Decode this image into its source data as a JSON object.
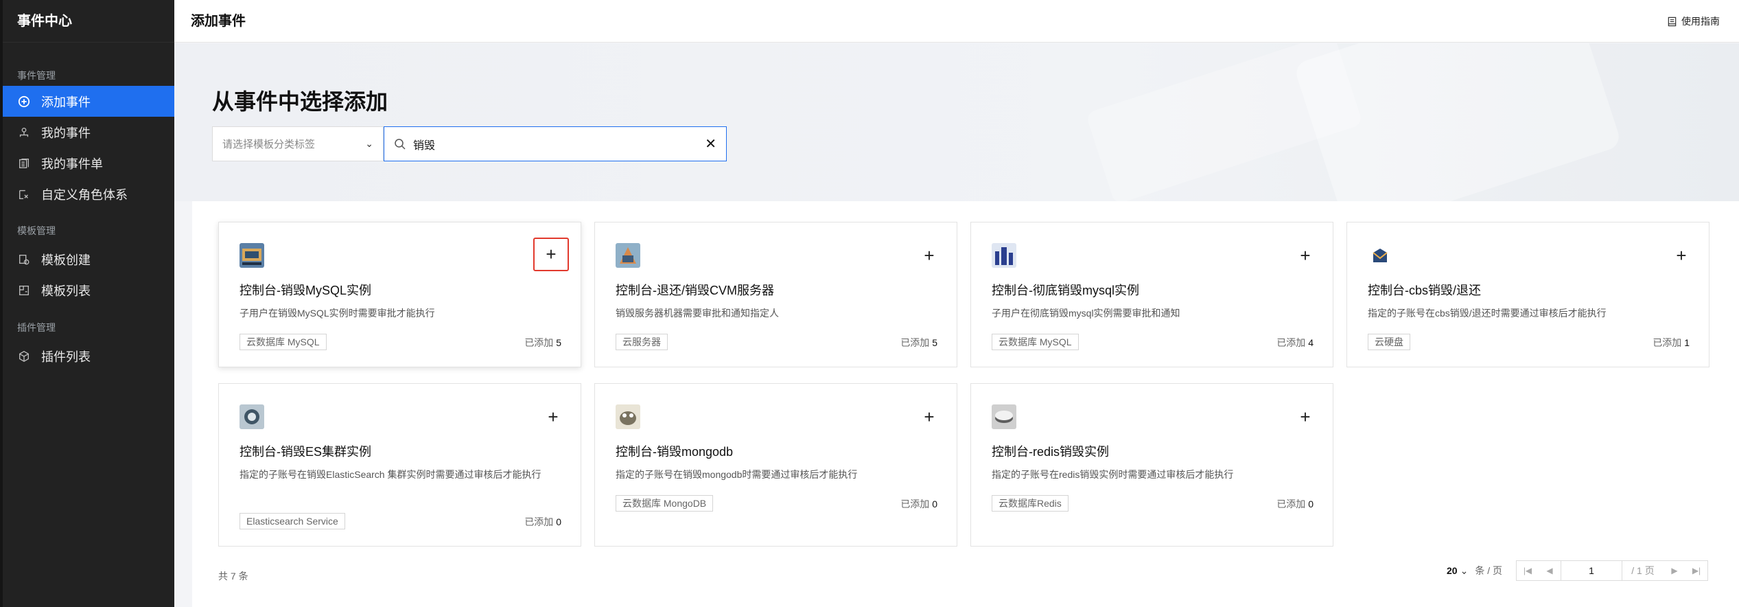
{
  "app": {
    "title": "事件中心"
  },
  "sidebar": {
    "groups": [
      {
        "title": "事件管理",
        "items": [
          {
            "label": "添加事件",
            "icon": "plus-circle-icon",
            "active": true
          },
          {
            "label": "我的事件",
            "icon": "user-org-icon"
          },
          {
            "label": "我的事件单",
            "icon": "document-list-icon"
          },
          {
            "label": "自定义角色体系",
            "icon": "role-system-icon"
          }
        ]
      },
      {
        "title": "模板管理",
        "items": [
          {
            "label": "模板创建",
            "icon": "template-create-icon"
          },
          {
            "label": "模板列表",
            "icon": "template-list-icon"
          }
        ]
      },
      {
        "title": "插件管理",
        "items": [
          {
            "label": "插件列表",
            "icon": "cube-icon"
          }
        ]
      }
    ]
  },
  "header": {
    "title": "添加事件",
    "guide_label": "使用指南"
  },
  "main": {
    "section_title": "从事件中选择添加",
    "category_placeholder": "请选择模板分类标签",
    "search_value": "销毁",
    "cards": [
      {
        "name": "控制台-销毁MySQL实例",
        "desc": "子用户在销毁MySQL实例时需要审批才能执行",
        "tag": "云数据库 MySQL",
        "added_label": "已添加",
        "added_count": "5",
        "logo_color": "#4b6b8f"
      },
      {
        "name": "控制台-退还/销毁CVM服务器",
        "desc": "销毁服务器机器需要审批和通知指定人",
        "tag": "云服务器",
        "added_label": "已添加",
        "added_count": "5",
        "logo_color": "#3d5a7a"
      },
      {
        "name": "控制台-彻底销毁mysql实例",
        "desc": "子用户在彻底销毁mysql实例需要审批和通知",
        "tag": "云数据库 MySQL",
        "added_label": "已添加",
        "added_count": "4",
        "logo_color": "#2b3f8f"
      },
      {
        "name": "控制台-cbs销毁/退还",
        "desc": "指定的子账号在cbs销毁/退还时需要通过审核后才能执行",
        "tag": "云硬盘",
        "added_label": "已添加",
        "added_count": "1",
        "logo_color": "#2b4a7a"
      },
      {
        "name": "控制台-销毁ES集群实例",
        "desc": "指定的子账号在销毁ElasticSearch 集群实例时需要通过审核后才能执行",
        "tag": "Elasticsearch Service",
        "added_label": "已添加",
        "added_count": "0",
        "logo_color": "#5a6f80"
      },
      {
        "name": "控制台-销毁mongodb",
        "desc": "指定的子账号在销毁mongodb时需要通过审核后才能执行",
        "tag": "云数据库 MongoDB",
        "added_label": "已添加",
        "added_count": "0",
        "logo_color": "#8a8a7a"
      },
      {
        "name": "控制台-redis销毁实例",
        "desc": "指定的子账号在redis销毁实例时需要通过审核后才能执行",
        "tag": "云数据库Redis",
        "added_label": "已添加",
        "added_count": "0",
        "logo_color": "#777777"
      }
    ],
    "total_label": "共 7 条",
    "pagination": {
      "page_size": "20",
      "page_size_unit": "条 / 页",
      "current_page": "1",
      "total_pages": "/ 1 页"
    }
  },
  "colors": {
    "accent": "#1f6fef",
    "highlight": "#e2392d",
    "sidebar_bg": "#222222"
  }
}
